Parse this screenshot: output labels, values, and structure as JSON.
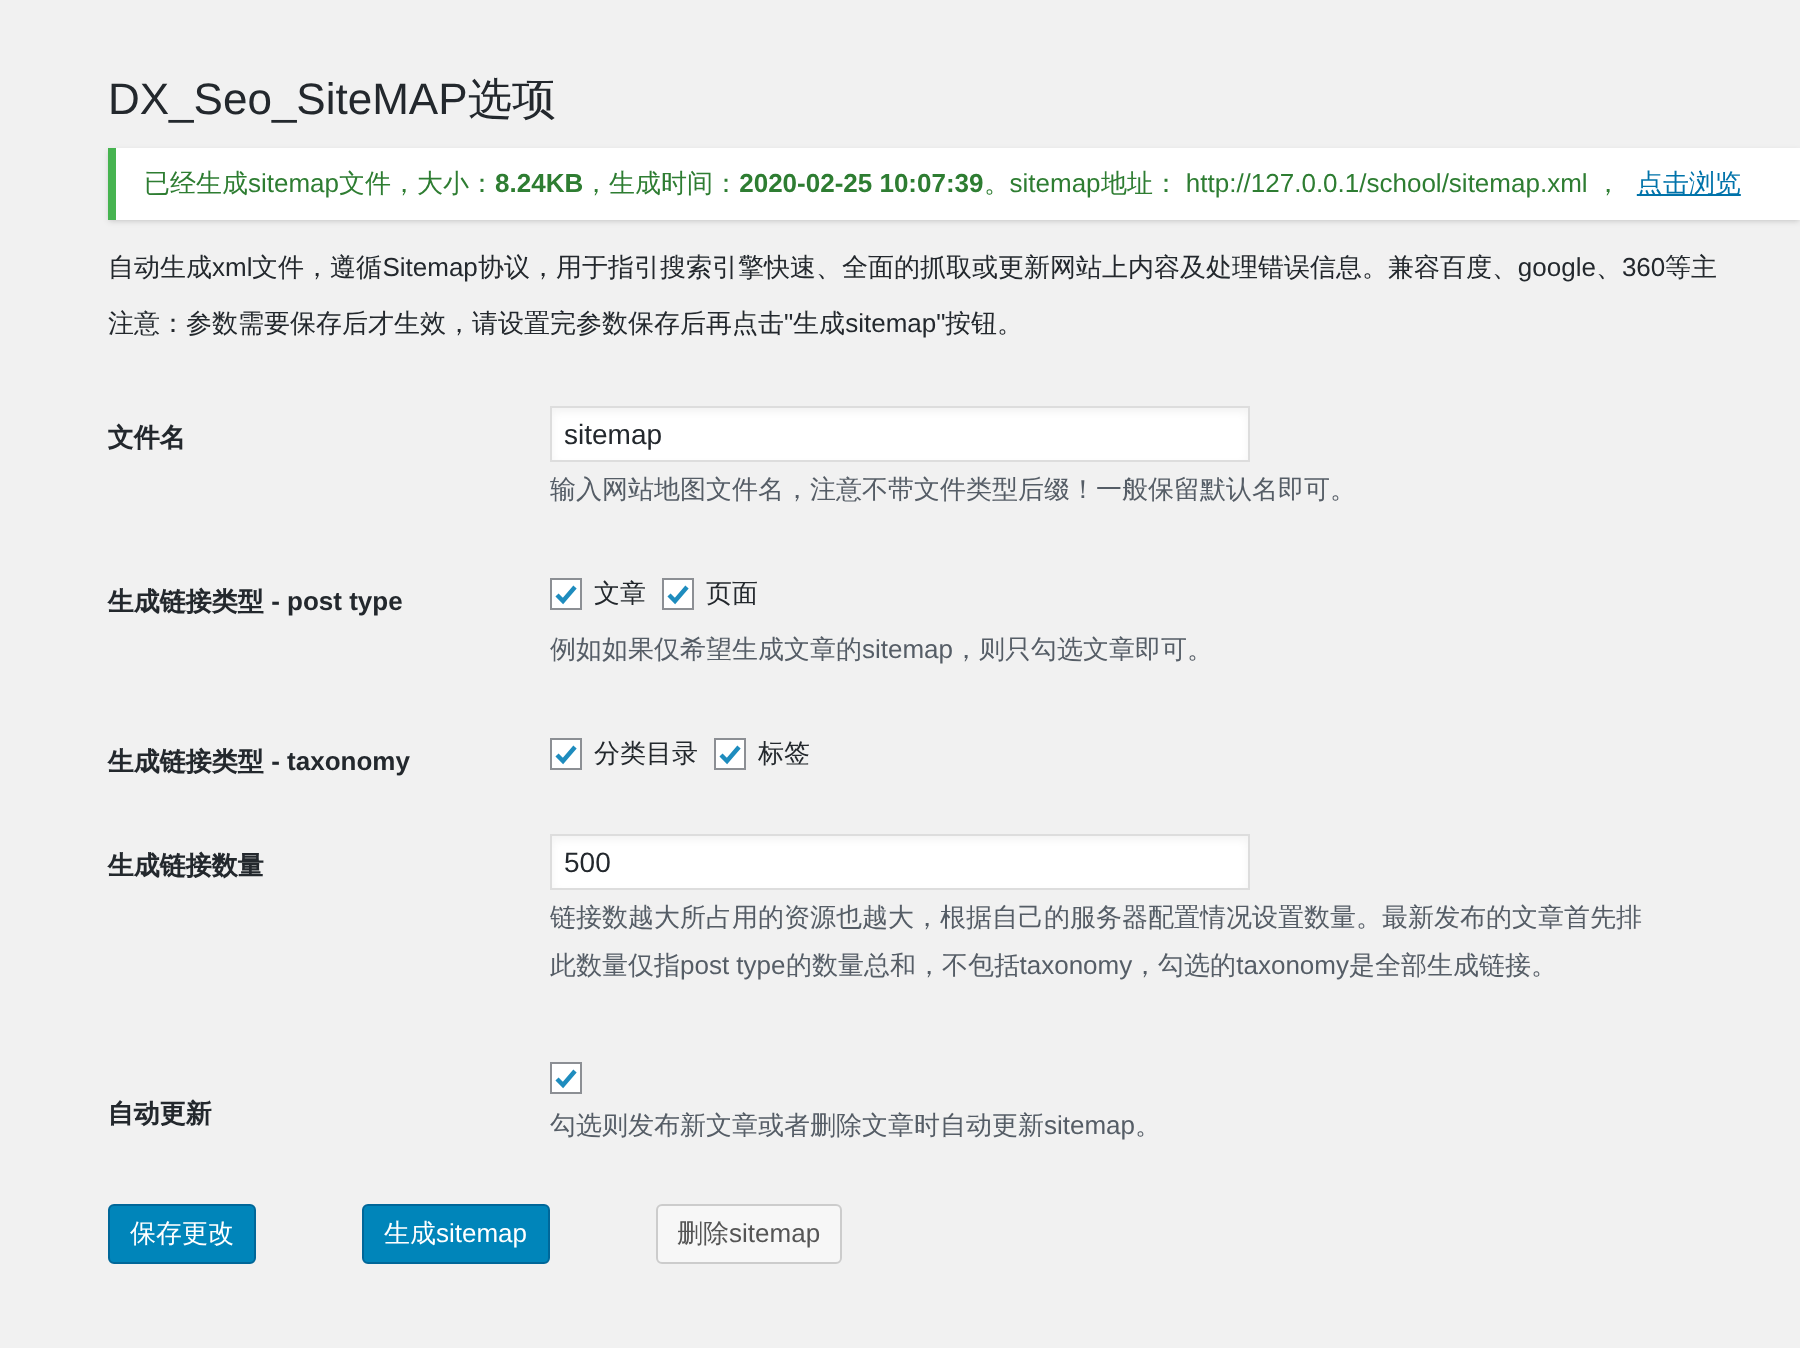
{
  "title": "DX_Seo_SiteMAP选项",
  "notice": {
    "message": "已经生成sitemap文件，大小：**8.24KB**，生成时间：**2020-02-25 10:07:39**。sitemap地址： http://127.0.0.1/school/sitemap.xml ，",
    "link": "点击浏览"
  },
  "description": [
    "自动生成xml文件，遵循Sitemap协议，用于指引搜索引擎快速、全面的抓取或更新网站上内容及处理错误信息。兼容百度、google、360等主",
    "注意：参数需要保存后才生效，请设置完参数保存后再点击\"生成sitemap\"按钮。"
  ],
  "fields": [
    {
      "kind": "text",
      "label": "文件名",
      "value": "sitemap",
      "help": [
        "输入网站地图文件名，注意不带文件类型后缀！一般保留默认名即可。"
      ]
    },
    {
      "kind": "checkboxes",
      "label": "生成链接类型 - post type",
      "options": [
        {
          "label": "文章",
          "checked": true
        },
        {
          "label": "页面",
          "checked": true
        }
      ],
      "help": [
        "例如如果仅希望生成文章的sitemap，则只勾选文章即可。"
      ]
    },
    {
      "kind": "checkboxes",
      "label": "生成链接类型 - taxonomy",
      "options": [
        {
          "label": "分类目录",
          "checked": true
        },
        {
          "label": "标签",
          "checked": true
        }
      ]
    },
    {
      "kind": "text",
      "label": "生成链接数量",
      "value": "500",
      "help": [
        "链接数越大所占用的资源也越大，根据自己的服务器配置情况设置数量。最新发布的文章首先排",
        "此数量仅指post type的数量总和，不包括taxonomy，勾选的taxonomy是全部生成链接。"
      ]
    },
    {
      "kind": "checkbox",
      "label": "自动更新",
      "checked": true,
      "help": [
        "勾选则发布新文章或者删除文章时自动更新sitemap。"
      ]
    }
  ],
  "buttons": [
    {
      "label": "保存更改",
      "kind": "primary"
    },
    {
      "label": "生成sitemap",
      "kind": "primary"
    },
    {
      "label": "删除sitemap",
      "kind": "secondary"
    }
  ]
}
